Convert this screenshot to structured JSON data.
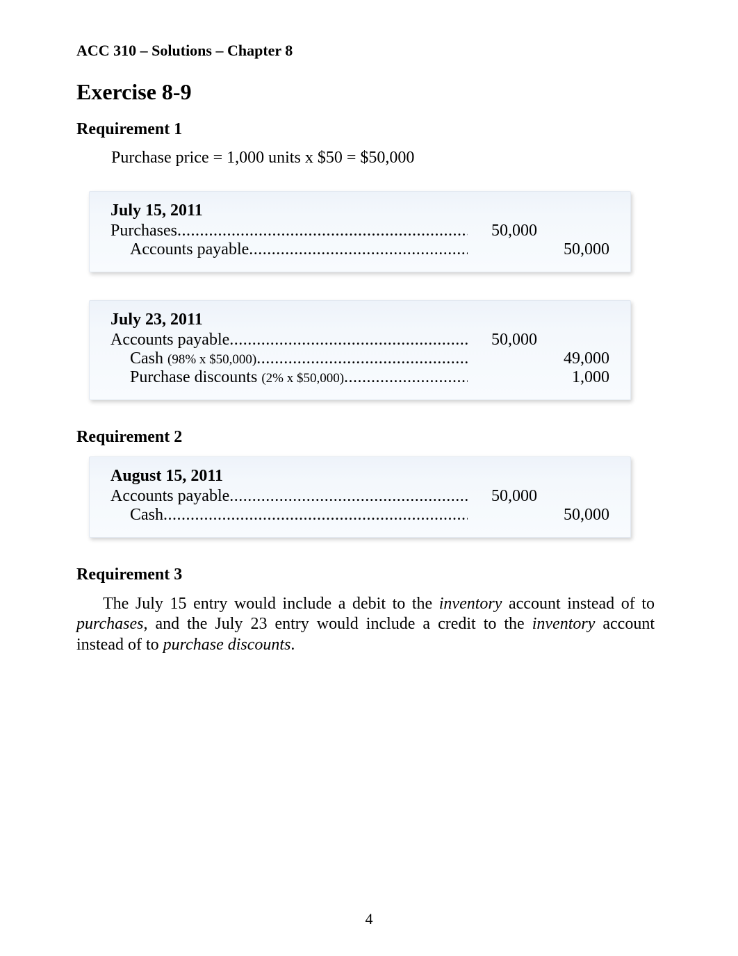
{
  "header": "ACC 310 – Solutions – Chapter 8",
  "exercise_title": "Exercise 8-9",
  "req1": {
    "title": "Requirement 1",
    "calc": "Purchase price   =  1,000 units x $50  =  $50,000"
  },
  "entry1": {
    "date": "July 15, 2011",
    "line1": {
      "label": "Purchases",
      "dr": "50,000",
      "cr": ""
    },
    "line2": {
      "label": "Accounts payable",
      "dr": "",
      "cr": "50,000"
    }
  },
  "entry2": {
    "date": "July 23, 2011",
    "line1": {
      "label": "Accounts payable",
      "dr": "50,000",
      "cr": ""
    },
    "line2": {
      "label": "Cash",
      "note": "(98% x $50,000)",
      "dr": "",
      "cr": "49,000"
    },
    "line3": {
      "label": "Purchase discounts",
      "note": "(2% x $50,000)",
      "dr": "",
      "cr": "1,000"
    }
  },
  "req2": {
    "title": "Requirement 2"
  },
  "entry3": {
    "date": "August 15, 2011",
    "line1": {
      "label": "Accounts payable",
      "dr": "50,000",
      "cr": ""
    },
    "line2": {
      "label": "Cash",
      "dr": "",
      "cr": "50,000"
    }
  },
  "req3": {
    "title": "Requirement 3",
    "t1": "The July 15 entry would include a debit to the ",
    "i1": "inventory",
    "t2": " account instead of to ",
    "i2": "purchases",
    "t3": ", and the July 23 entry would include a credit to the ",
    "i3": "inventory",
    "t4": " account instead of to ",
    "i4": "purchase discounts",
    "t5": "."
  },
  "page_number": "4"
}
